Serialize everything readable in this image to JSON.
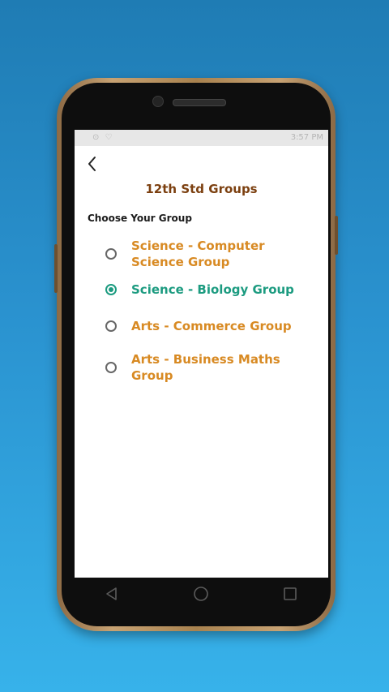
{
  "status_bar": {
    "time": "3:57 PM"
  },
  "header": {
    "title": "12th Std Groups"
  },
  "section": {
    "label": "Choose Your Group"
  },
  "options": [
    {
      "label_line1": "Science - Computer",
      "label_line2": "Science Group",
      "selected": false
    },
    {
      "label_line1": "Science - Biology Group",
      "label_line2": "",
      "selected": true
    },
    {
      "label_line1": "Arts - Commerce Group",
      "label_line2": "",
      "selected": false
    },
    {
      "label_line1": "Arts - Business  Maths",
      "label_line2": "Group",
      "selected": false
    }
  ],
  "icons": {
    "back": "back-arrow-icon",
    "nav_back": "triangle-back-icon",
    "nav_home": "circle-home-icon",
    "nav_recent": "square-recent-icon"
  },
  "colors": {
    "title": "#7c4010",
    "option_text": "#d88a23",
    "selected": "#1c9b80"
  }
}
